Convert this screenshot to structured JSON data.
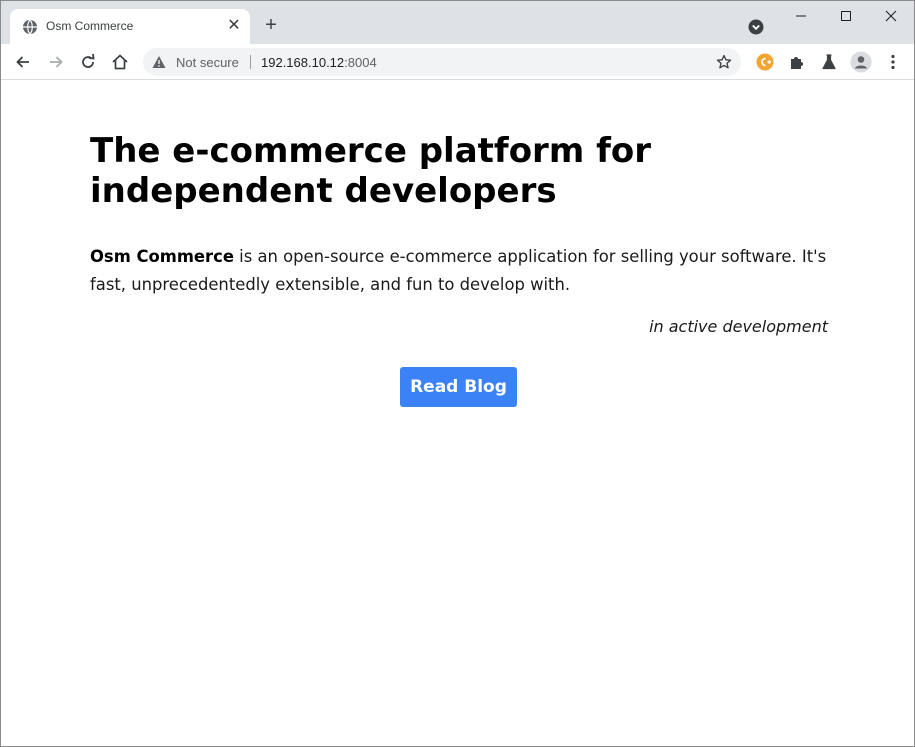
{
  "browser": {
    "tab": {
      "title": "Osm Commerce",
      "close_glyph": "✕"
    },
    "new_tab_glyph": "+",
    "address_bar": {
      "security_label": "Not secure",
      "url_host": "192.168.10.12",
      "url_port": ":8004"
    },
    "icons": {
      "favicon": "globe-icon",
      "tab_search": "tab-search-icon",
      "back": "back-arrow-icon",
      "forward": "forward-arrow-icon",
      "reload": "reload-icon",
      "home": "home-icon",
      "warning": "warning-icon",
      "bookmark": "star-icon",
      "extension_1": "c-plus-extension-icon",
      "extensions": "puzzle-icon",
      "labs": "flask-icon",
      "profile": "profile-icon",
      "menu": "more-vert-icon"
    }
  },
  "page": {
    "headline": "The e-commerce platform for independent developers",
    "intro": {
      "brand": "Osm Commerce",
      "text": " is an open-source e-commerce application for selling your software. It's fast, unprecedentedly extensible, and fun to develop with."
    },
    "status_note": "in active development",
    "cta_label": "Read Blog"
  },
  "colors": {
    "cta_background": "#3b82f6",
    "tabstrip": "#dee1e6",
    "omnibox": "#f1f3f4"
  }
}
